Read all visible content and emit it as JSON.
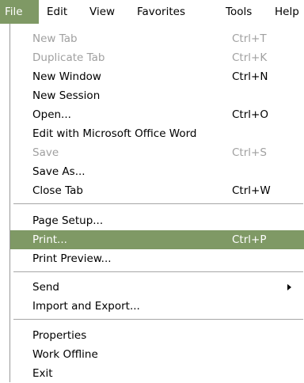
{
  "menubar": {
    "items": [
      {
        "label": "File"
      },
      {
        "label": "Edit"
      },
      {
        "label": "View"
      },
      {
        "label": "Favorites"
      },
      {
        "label": "Tools"
      },
      {
        "label": "Help"
      }
    ]
  },
  "file_menu": {
    "items": [
      {
        "label": "New Tab",
        "shortcut": "Ctrl+T",
        "enabled": false
      },
      {
        "label": "Duplicate Tab",
        "shortcut": "Ctrl+K",
        "enabled": false
      },
      {
        "label": "New Window",
        "shortcut": "Ctrl+N",
        "enabled": true
      },
      {
        "label": "New Session",
        "shortcut": "",
        "enabled": true
      },
      {
        "label": "Open...",
        "shortcut": "Ctrl+O",
        "enabled": true
      },
      {
        "label": "Edit with Microsoft Office Word",
        "shortcut": "",
        "enabled": true
      },
      {
        "label": "Save",
        "shortcut": "Ctrl+S",
        "enabled": false
      },
      {
        "label": "Save As...",
        "shortcut": "",
        "enabled": true
      },
      {
        "label": "Close Tab",
        "shortcut": "Ctrl+W",
        "enabled": true
      },
      {
        "label": "Page Setup...",
        "shortcut": "",
        "enabled": true
      },
      {
        "label": "Print...",
        "shortcut": "Ctrl+P",
        "enabled": true,
        "highlighted": true
      },
      {
        "label": "Print Preview...",
        "shortcut": "",
        "enabled": true
      },
      {
        "label": "Send",
        "shortcut": "",
        "enabled": true,
        "submenu": true
      },
      {
        "label": "Import and Export...",
        "shortcut": "",
        "enabled": true
      },
      {
        "label": "Properties",
        "shortcut": "",
        "enabled": true
      },
      {
        "label": "Work Offline",
        "shortcut": "",
        "enabled": true
      },
      {
        "label": "Exit",
        "shortcut": "",
        "enabled": true
      }
    ]
  },
  "colors": {
    "highlight": "#7f9965",
    "disabled_text": "#a0a0a0",
    "separator": "#a6a6a6"
  }
}
